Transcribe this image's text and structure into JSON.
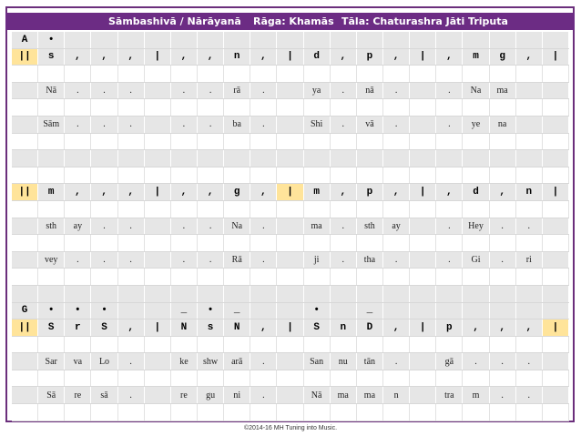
{
  "header": {
    "title": "Sāmbashivā / Nārāyanā",
    "raga": "Rāga:  Khamās",
    "tala": "Tāla:  Chaturashra Jāti Triputa"
  },
  "footer": "©2014-16 MH  Tuning into Music.",
  "highlight_color": "#ffe49a",
  "title_color": "#6c2c84",
  "rows": [
    {
      "type": "octave",
      "cells": [
        "A",
        "•",
        "",
        "",
        "",
        "",
        "",
        "",
        "",
        "",
        "",
        "",
        "",
        "",
        "",
        "",
        "",
        ""
      ]
    },
    {
      "type": "swara",
      "cells": [
        "||",
        "s",
        ",",
        ",",
        ",",
        "|",
        ",",
        ",",
        "n",
        ",",
        "|",
        "d",
        ",",
        "p",
        ",",
        "|",
        ",",
        "m",
        "g",
        ",",
        "|"
      ],
      "hl": [
        0,
        22
      ]
    },
    {
      "type": "blank",
      "cells": []
    },
    {
      "type": "lyric",
      "cells": [
        "",
        "Nā",
        ".",
        ".",
        ".",
        "",
        ".",
        ".",
        "rā",
        ".",
        "",
        "ya",
        ".",
        "nā",
        ".",
        "",
        ".",
        "Na",
        "ma",
        "",
        ""
      ]
    },
    {
      "type": "blank",
      "cells": []
    },
    {
      "type": "lyric",
      "cells": [
        "",
        "Sām",
        ".",
        ".",
        ".",
        "",
        ".",
        ".",
        "ba",
        ".",
        "",
        "Shi",
        ".",
        "vā",
        ".",
        "",
        ".",
        "ye",
        "na",
        "",
        ""
      ]
    },
    {
      "type": "blank",
      "cells": []
    },
    {
      "type": "blank",
      "cells": []
    },
    {
      "type": "blank",
      "cells": []
    },
    {
      "type": "swara",
      "cells": [
        "||",
        "m",
        ",",
        ",",
        ",",
        "|",
        ",",
        ",",
        "g",
        ",",
        "|",
        "m",
        ",",
        "p",
        ",",
        "|",
        ",",
        "d",
        ",",
        "n",
        "|"
      ],
      "hl": [
        0,
        10,
        22
      ]
    },
    {
      "type": "blank",
      "cells": []
    },
    {
      "type": "lyric",
      "cells": [
        "",
        "sth",
        "ay",
        ".",
        ".",
        "",
        ".",
        ".",
        "Na",
        ".",
        "",
        "ma",
        ".",
        "sth",
        "ay",
        "",
        ".",
        "Hey",
        ".",
        ".",
        ""
      ]
    },
    {
      "type": "blank",
      "cells": []
    },
    {
      "type": "lyric",
      "cells": [
        "",
        "vey",
        ".",
        ".",
        ".",
        "",
        ".",
        ".",
        "Rā",
        ".",
        "",
        "ji",
        ".",
        "tha",
        ".",
        "",
        ".",
        "Gi",
        ".",
        "ri"
      ]
    },
    {
      "type": "blank",
      "cells": []
    },
    {
      "type": "blank",
      "cells": []
    },
    {
      "type": "octave",
      "cells": [
        "G",
        "•",
        "•",
        "•",
        "",
        "",
        "_",
        "•",
        "_",
        "",
        "",
        "•",
        "",
        "_",
        "",
        "",
        "",
        "",
        "",
        "",
        ""
      ]
    },
    {
      "type": "swara",
      "cells": [
        "||",
        "S",
        "r",
        "S",
        ",",
        "|",
        "N",
        "s",
        "N",
        ",",
        "|",
        "S",
        "n",
        "D",
        ",",
        "|",
        "p",
        ",",
        ",",
        ",",
        "|"
      ],
      "hl": [
        0,
        20
      ]
    },
    {
      "type": "blank",
      "cells": []
    },
    {
      "type": "lyric",
      "cells": [
        "",
        "Sar",
        "va",
        "Lo",
        ".",
        "",
        "ke",
        "shw",
        "arā",
        ".",
        "",
        "San",
        "nu",
        "tān",
        ".",
        "",
        "gā",
        ".",
        ".",
        ".",
        ""
      ]
    },
    {
      "type": "blank",
      "cells": []
    },
    {
      "type": "lyric",
      "cells": [
        "",
        "Sā",
        "re",
        "sā",
        ".",
        "",
        "re",
        "gu",
        "ni",
        ".",
        "",
        "Nā",
        "ma",
        "ma",
        "n",
        "",
        "tra",
        "m",
        ".",
        ".",
        ""
      ]
    },
    {
      "type": "blank",
      "cells": []
    }
  ]
}
